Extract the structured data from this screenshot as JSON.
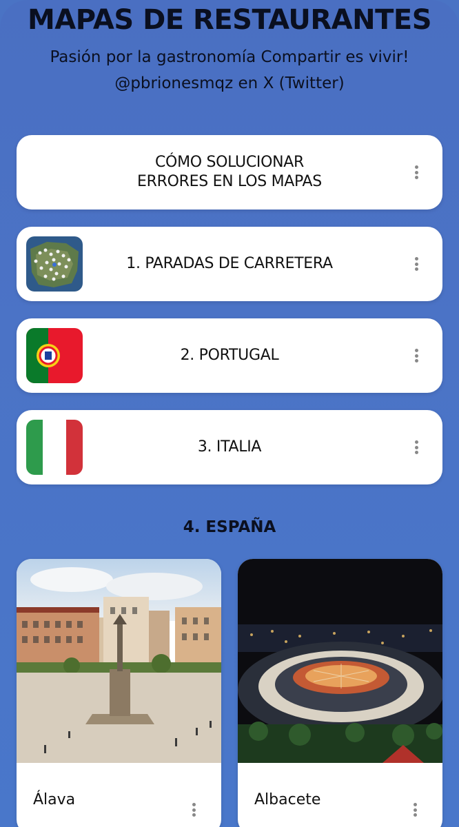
{
  "header": {
    "title": "MAPAS DE RESTAURANTES",
    "subtitle": "Pasión por la gastronomía Compartir es vivir! @pbrionesmqz en X (Twitter)"
  },
  "links": [
    {
      "label": "CÓMO SOLUCIONAR\nERRORES EN LOS MAPAS",
      "thumbnail": null
    },
    {
      "label": "1. PARADAS DE CARRETERA",
      "thumbnail": "map-thumbnail"
    },
    {
      "label": "2. PORTUGAL",
      "thumbnail": "portugal-flag"
    },
    {
      "label": "3. ITALIA",
      "thumbnail": "italy-flag"
    }
  ],
  "section": {
    "heading": "4. ESPAÑA"
  },
  "tiles": [
    {
      "label": "Álava",
      "image": "vitoria-plaza-photo"
    },
    {
      "label": "Albacete",
      "image": "albacete-fair-night-photo"
    }
  ],
  "colors": {
    "background": "#4a73c4",
    "card": "#ffffff",
    "text": "#111111",
    "portugal_green": "#0a7a2a",
    "portugal_red": "#e8192c",
    "italy_green": "#2e9b4c",
    "italy_red": "#d2323a"
  },
  "icons": {
    "more": "more-vertical-icon"
  }
}
